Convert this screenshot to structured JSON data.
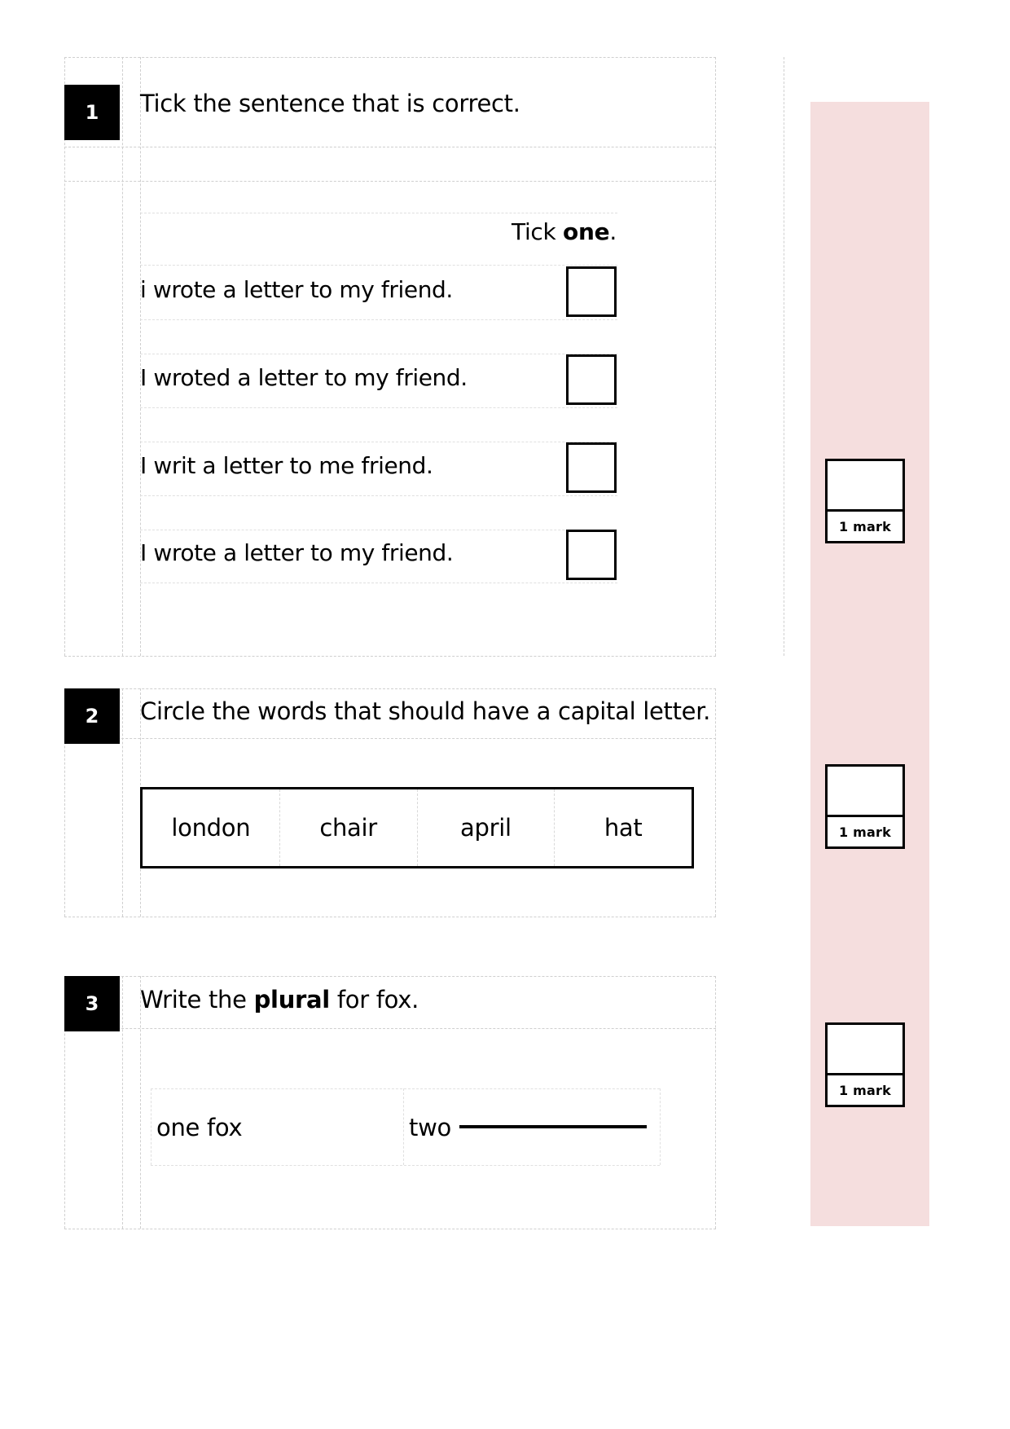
{
  "page": {
    "margin_band_color": "#f5dede",
    "ink_color": "#000000",
    "paper_color": "#ffffff"
  },
  "questions": [
    {
      "number": "1",
      "prompt": "Tick the sentence that is correct.",
      "instruction_prefix": "Tick ",
      "instruction_bold": "one",
      "instruction_suffix": ".",
      "options": [
        {
          "text": "i wrote a letter to my friend."
        },
        {
          "text": "I wroted a letter to my friend."
        },
        {
          "text": "I writ a letter to me friend."
        },
        {
          "text": "I wrote a letter to my friend."
        }
      ],
      "mark": {
        "value": "1 mark"
      }
    },
    {
      "number": "2",
      "prompt": "Circle the words that should have a capital letter.",
      "words": [
        "london",
        "chair",
        "april",
        "hat"
      ],
      "mark": {
        "value": "1 mark"
      }
    },
    {
      "number": "3",
      "prompt_prefix": "Write the ",
      "prompt_bold": "plural",
      "prompt_suffix": " for fox.",
      "given": "one fox",
      "answer_prefix": "two",
      "answer_value": "",
      "mark": {
        "value": "1 mark"
      }
    }
  ]
}
